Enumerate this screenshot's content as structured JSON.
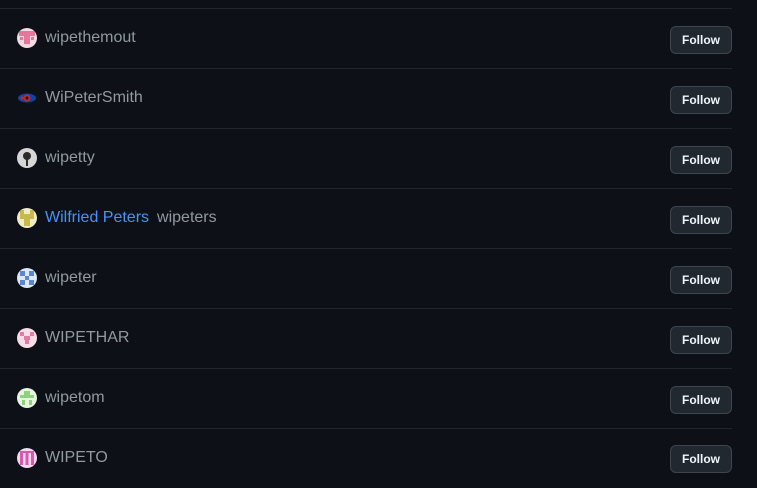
{
  "follow_label": "Follow",
  "users": [
    {
      "full_name": "",
      "login": "wipethemout",
      "avatar_icon": "identicon-pink-avatar",
      "avatar_color": "#e8769a",
      "avatar_bg": "#f3dbe4"
    },
    {
      "full_name": "",
      "login": "WiPeterSmith",
      "avatar_icon": "eye-photo-avatar",
      "avatar_color": "#c62828",
      "avatar_bg": "#0d47a1"
    },
    {
      "full_name": "",
      "login": "wipetty",
      "avatar_icon": "gray-photo-avatar",
      "avatar_color": "#2b2b2b",
      "avatar_bg": "#d6d6d6"
    },
    {
      "full_name": "Wilfried Peters",
      "login": "wipeters",
      "avatar_icon": "identicon-olive-avatar",
      "avatar_color": "#c9b94a",
      "avatar_bg": "#f1ecc8"
    },
    {
      "full_name": "",
      "login": "wipeter",
      "avatar_icon": "identicon-blue-avatar",
      "avatar_color": "#5b86d6",
      "avatar_bg": "#dfe8f7"
    },
    {
      "full_name": "",
      "login": "WIPETHAR",
      "avatar_icon": "identicon-pink-avatar",
      "avatar_color": "#e57aa6",
      "avatar_bg": "#f6dde8"
    },
    {
      "full_name": "",
      "login": "wipetom",
      "avatar_icon": "identicon-green-avatar",
      "avatar_color": "#8fd17f",
      "avatar_bg": "#e6f4e0"
    },
    {
      "full_name": "",
      "login": "WIPETO",
      "avatar_icon": "identicon-magenta-avatar",
      "avatar_color": "#d65bb0",
      "avatar_bg": "#f5d9ec"
    }
  ]
}
